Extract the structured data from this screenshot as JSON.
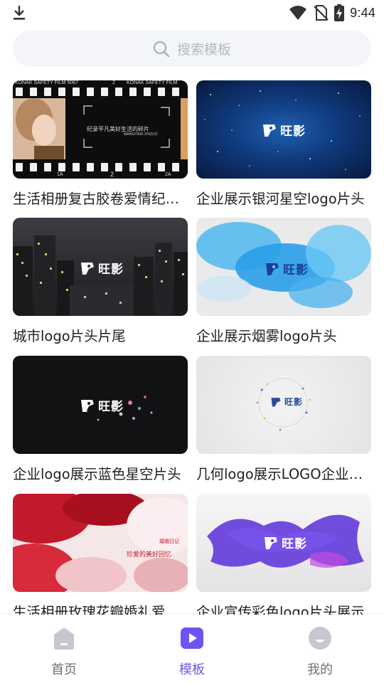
{
  "status_bar": {
    "time": "9:44",
    "icons": [
      "download-icon",
      "wifi-icon",
      "no-sim-icon",
      "battery-charging-icon"
    ]
  },
  "search": {
    "placeholder": "搜索模板"
  },
  "templates": [
    {
      "title": "生活相册复古胶卷爱情纪念相册",
      "film_top": "KONAK SAFETY FILM 5067",
      "film_mid": "2",
      "film_top2": "KONAK SAFETY FILM",
      "caption": "纪录平凡美好生活的碎片",
      "caption_sub": "WANGYING ZHIZUO",
      "film_bottom_a": "1A",
      "film_bottom_b": "2",
      "film_bottom_c": "2A"
    },
    {
      "title": "企业展示银河星空logo片头",
      "brand": "旺影"
    },
    {
      "title": "城市logo片头片尾",
      "brand": "旺影"
    },
    {
      "title": "企业展示烟雾logo片头",
      "brand": "旺影"
    },
    {
      "title": "企业logo展示蓝色星空片头",
      "brand": "旺影"
    },
    {
      "title": "几何logo展示LOGO企业片头",
      "brand": "旺影"
    },
    {
      "title": "生活相册玫瑰花瓣婚礼爱情相册",
      "caption": "婚姻日记",
      "caption_sub": "珍爱的美好回忆"
    },
    {
      "title": "企业宣传彩色logo片头展示",
      "brand": "旺影"
    }
  ],
  "bottom_nav": [
    {
      "label": "首页",
      "icon": "home-icon",
      "active": false
    },
    {
      "label": "模板",
      "icon": "template-play-icon",
      "active": true
    },
    {
      "label": "我的",
      "icon": "profile-icon",
      "active": false
    }
  ],
  "colors": {
    "accent": "#6b55f1",
    "nav_inactive": "#6c6f7b",
    "search_bg": "#f4f5f9"
  }
}
